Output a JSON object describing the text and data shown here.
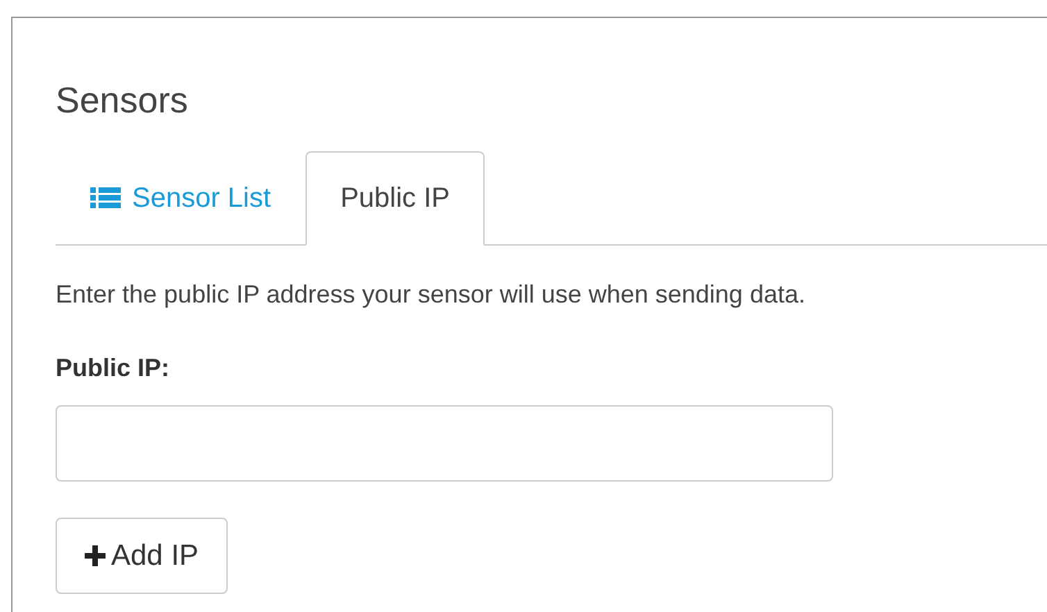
{
  "panel": {
    "title": "Sensors"
  },
  "tabs": [
    {
      "label": "Sensor List",
      "selected": false,
      "kind": "list"
    },
    {
      "label": "Public IP",
      "selected": true,
      "kind": "plain"
    }
  ],
  "description": "Enter the public IP address your sensor will use when sending data.",
  "field": {
    "label": "Public IP:"
  },
  "button": {
    "label": "Add IP",
    "kind": "add"
  }
}
